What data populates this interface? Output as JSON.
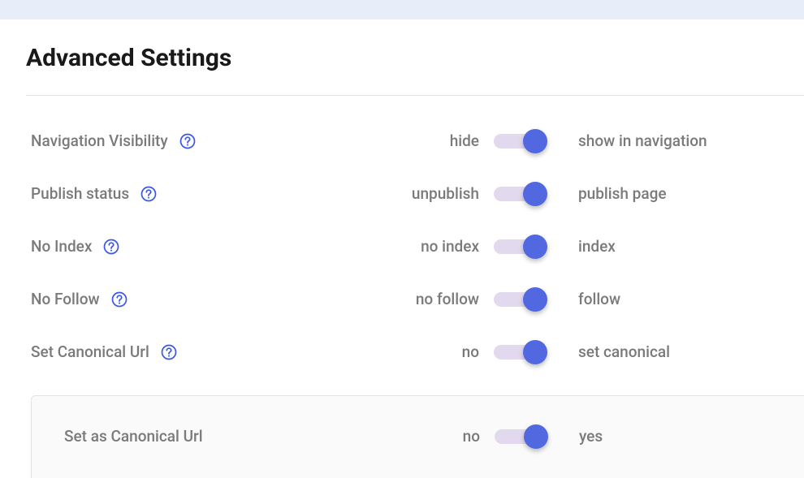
{
  "title": "Advanced Settings",
  "settings": {
    "nav_visibility": {
      "label": "Navigation Visibility",
      "off": "hide",
      "on": "show in navigation"
    },
    "publish_status": {
      "label": "Publish status",
      "off": "unpublish",
      "on": "publish page"
    },
    "no_index": {
      "label": "No Index",
      "off": "no index",
      "on": "index"
    },
    "no_follow": {
      "label": "No Follow",
      "off": "no follow",
      "on": "follow"
    },
    "set_canonical": {
      "label": "Set Canonical Url",
      "off": "no",
      "on": "set canonical"
    }
  },
  "sub_panel": {
    "set_as_canonical": {
      "label": "Set as Canonical Url",
      "off": "no",
      "on": "yes"
    }
  }
}
